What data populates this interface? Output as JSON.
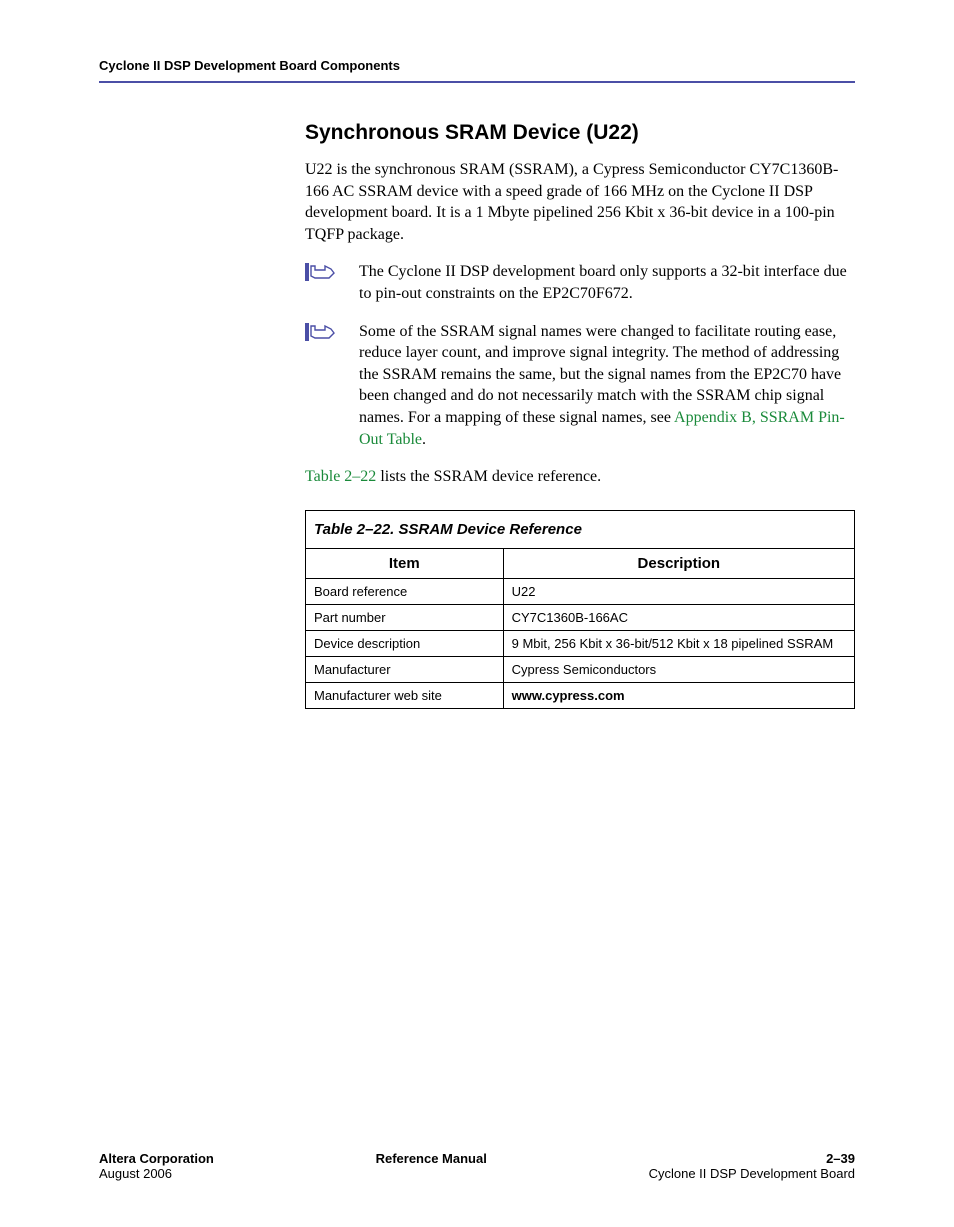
{
  "header": {
    "running_title": "Cyclone II DSP Development Board Components"
  },
  "section": {
    "heading": "Synchronous SRAM Device (U22)",
    "intro": "U22 is the synchronous SRAM (SSRAM), a Cypress Semiconductor CY7C1360B-166 AC SSRAM device with a speed grade of 166 MHz on the Cyclone II DSP development board. It is a 1 Mbyte pipelined 256 Kbit x 36-bit device in a 100-pin TQFP package.",
    "note1": "The Cyclone II DSP development board only supports a 32-bit interface due to pin-out constraints on the EP2C70F672.",
    "note2_pre": "Some of the SSRAM signal names were changed to facilitate routing ease, reduce layer count, and improve signal integrity. The method of addressing the SSRAM remains the same, but the signal names from the EP2C70 have been changed and do not necessarily match with the SSRAM chip signal names. For a mapping of these signal names, see ",
    "note2_link": "Appendix B, SSRAM Pin-Out Table",
    "note2_post": ".",
    "table_lead_pre": "",
    "table_lead_ref": "Table 2–22",
    "table_lead_post": " lists the SSRAM device reference."
  },
  "table": {
    "caption": "Table 2–22. SSRAM Device Reference",
    "header_item": "Item",
    "header_desc": "Description",
    "rows": [
      {
        "item": "Board reference",
        "desc": "U22"
      },
      {
        "item": "Part number",
        "desc": "CY7C1360B-166AC"
      },
      {
        "item": "Device description",
        "desc": "9 Mbit, 256 Kbit x 36-bit/512 Kbit x 18 pipelined SSRAM"
      },
      {
        "item": "Manufacturer",
        "desc": "Cypress Semiconductors"
      },
      {
        "item": "Manufacturer web site",
        "desc": "www.cypress.com"
      }
    ]
  },
  "footer": {
    "left_top": "Altera Corporation",
    "left_bottom": "August 2006",
    "center": "Reference Manual",
    "right_top": "2–39",
    "right_bottom": "Cyclone II DSP Development Board"
  },
  "icons": {
    "note": "note-hand-icon"
  }
}
